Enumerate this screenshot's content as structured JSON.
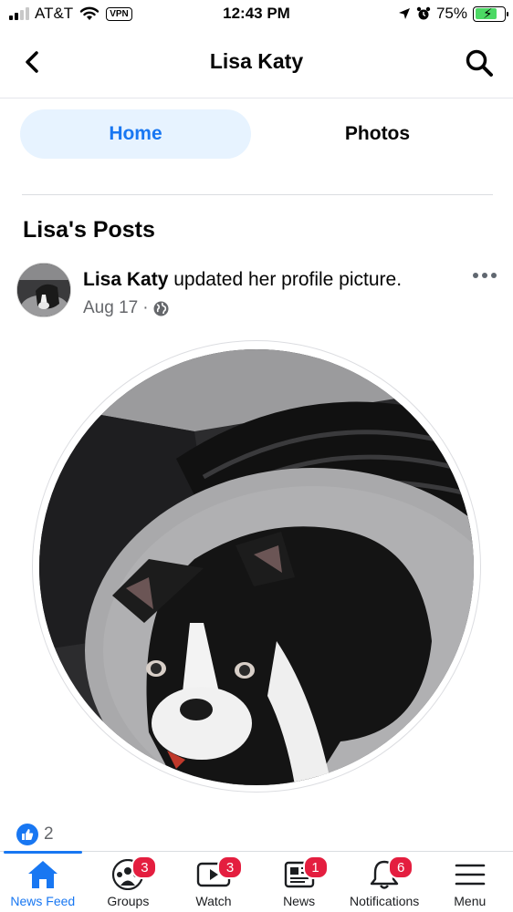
{
  "status_bar": {
    "carrier": "AT&T",
    "vpn": "VPN",
    "time": "12:43 PM",
    "battery_percent": "75%",
    "signal_bars_filled": 2,
    "signal_bars_total": 4,
    "battery_level": 0.75,
    "battery_color": "#4cd964"
  },
  "header": {
    "title": "Lisa Katy",
    "back_icon": "chevron-left-icon",
    "search_icon": "search-icon"
  },
  "tabs": [
    {
      "label": "Home",
      "active": true
    },
    {
      "label": "Photos",
      "active": false
    }
  ],
  "section": {
    "title": "Lisa's Posts"
  },
  "post": {
    "author": "Lisa Katy",
    "action": "updated her profile picture.",
    "date": "Aug 17",
    "separator": "·",
    "privacy_icon": "globe-icon",
    "reaction_icon": "like-icon",
    "reaction_count": "2"
  },
  "bottom_nav": [
    {
      "label": "News Feed",
      "icon": "home-icon",
      "badge": "",
      "active": true
    },
    {
      "label": "Groups",
      "icon": "groups-icon",
      "badge": "3",
      "active": false
    },
    {
      "label": "Watch",
      "icon": "watch-icon",
      "badge": "3",
      "active": false
    },
    {
      "label": "News",
      "icon": "news-icon",
      "badge": "1",
      "active": false
    },
    {
      "label": "Notifications",
      "icon": "bell-icon",
      "badge": "6",
      "active": false
    },
    {
      "label": "Menu",
      "icon": "menu-icon",
      "badge": "",
      "active": false
    }
  ],
  "colors": {
    "brand_blue": "#1877f2",
    "active_tab_bg": "#e7f3ff",
    "badge_red": "#e41e3f",
    "secondary_text": "#65676b"
  }
}
